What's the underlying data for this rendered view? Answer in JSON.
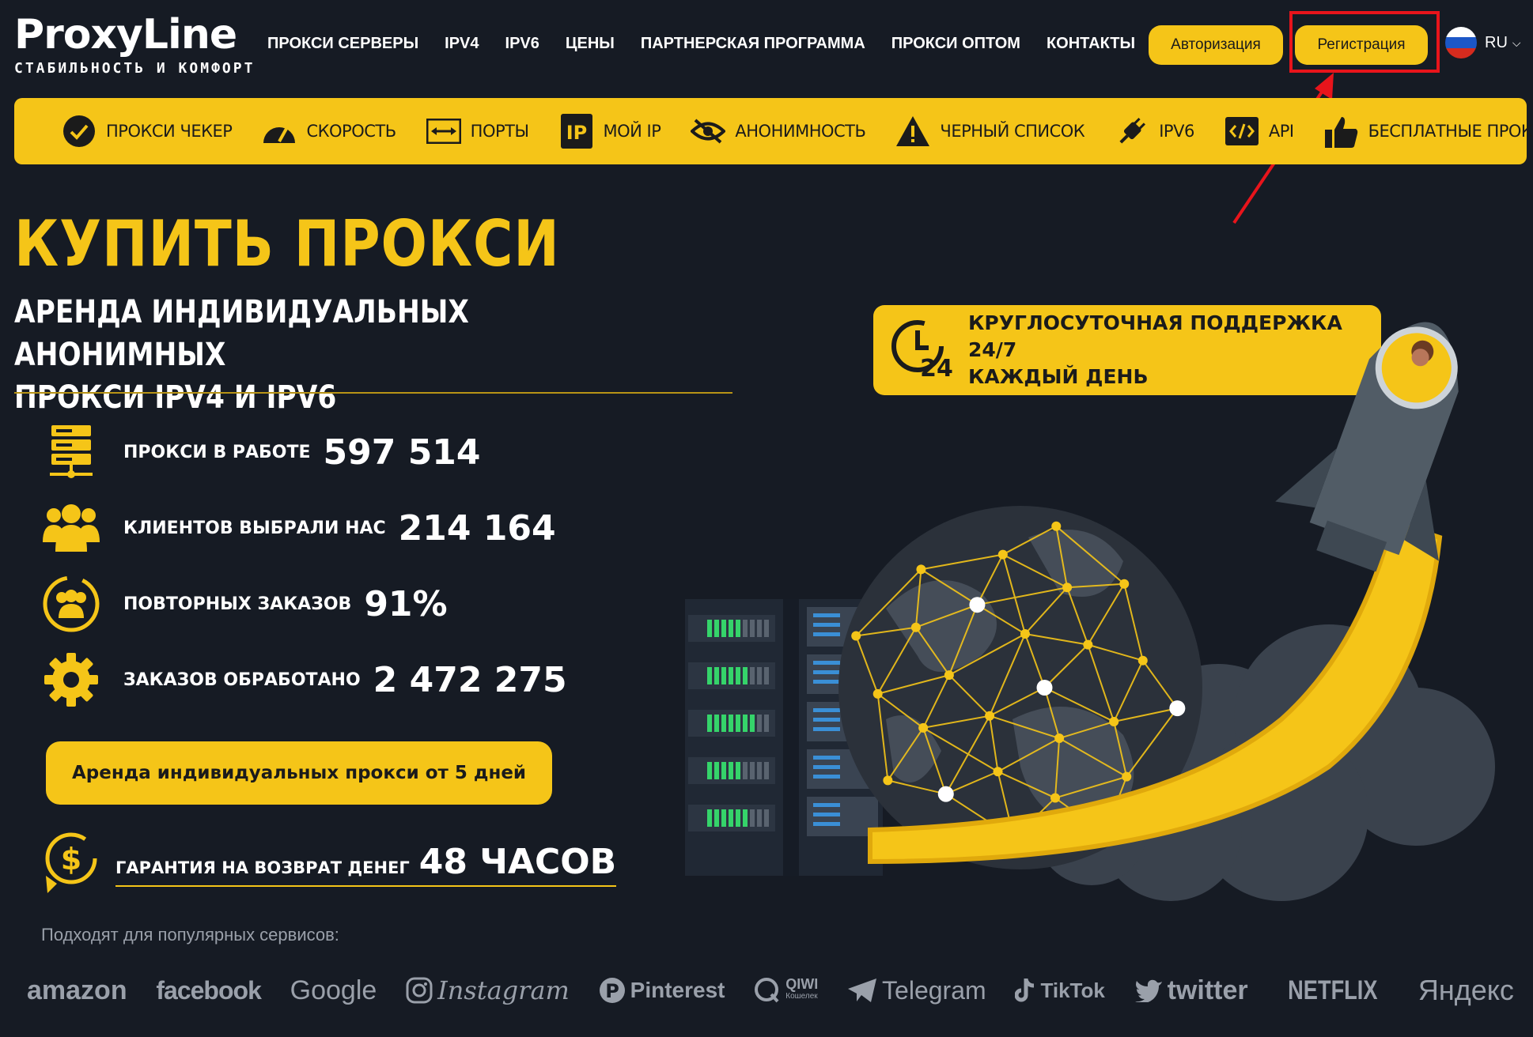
{
  "header": {
    "logo_main_a": "Proxy",
    "logo_main_b": "Line",
    "logo_sub": "СТАБИЛЬНОСТЬ И КОМФОРТ",
    "nav": [
      "ПРОКСИ СЕРВЕРЫ",
      "IPV4",
      "IPV6",
      "ЦЕНЫ",
      "ПАРТНЕРСКАЯ ПРОГРАММА",
      "ПРОКСИ ОПТОМ",
      "КОНТАКТЫ"
    ],
    "login_label": "Авторизация",
    "register_label": "Регистрация",
    "lang": "RU"
  },
  "toolbar": [
    {
      "label": "ПРОКСИ ЧЕКЕР",
      "icon": "check-circle-icon"
    },
    {
      "label": "СКОРОСТЬ",
      "icon": "speedometer-icon"
    },
    {
      "label": "ПОРТЫ",
      "icon": "arrows-horizontal-icon"
    },
    {
      "label": "МОЙ IP",
      "icon": "ip-icon"
    },
    {
      "label": "АНОНИМНОСТЬ",
      "icon": "eye-off-icon"
    },
    {
      "label": "ЧЕРНЫЙ СПИСОК",
      "icon": "warning-icon"
    },
    {
      "label": "IPV6",
      "icon": "plug-icon"
    },
    {
      "label": "API",
      "icon": "code-icon"
    },
    {
      "label": "БЕСПЛАТНЫЕ ПРОКСИ",
      "icon": "thumbs-up-icon"
    }
  ],
  "hero": {
    "title": "КУПИТЬ  ПРОКСИ",
    "subtitle_line1": "АРЕНДА ИНДИВИДУАЛЬНЫХ АНОНИМНЫХ",
    "subtitle_line2": "ПРОКСИ IPV4 И IPV6"
  },
  "stats": [
    {
      "label": "ПРОКСИ В РАБОТЕ",
      "value": "597 514",
      "icon": "server-icon"
    },
    {
      "label": "КЛИЕНТОВ ВЫБРАЛИ НАС",
      "value": "214 164",
      "icon": "users-icon"
    },
    {
      "label": "ПОВТОРНЫХ ЗАКАЗОВ",
      "value": "91%",
      "icon": "repeat-users-icon"
    },
    {
      "label": "ЗАКАЗОВ ОБРАБОТАНО",
      "value": "2 472 275",
      "icon": "gear-icon"
    }
  ],
  "rent_button": "Аренда индивидуальных прокси от 5 дней",
  "guarantee": {
    "label": "ГАРАНТИЯ НА ВОЗВРАТ ДЕНЕГ",
    "value": "48 ЧАСОВ"
  },
  "support": {
    "line1": "КРУГЛОСУТОЧНАЯ ПОДДЕРЖКА 24/7",
    "line2": "КАЖДЫЙ ДЕНЬ",
    "badge": "24"
  },
  "popular_label": "Подходят для популярных сервисов:",
  "brands": [
    "amazon",
    "facebook",
    "Google",
    "Instagram",
    "Pinterest",
    "QIWI",
    "Telegram",
    "TikTok",
    "twitter",
    "NETFLIX",
    "Яндекс"
  ],
  "brand_sub": {
    "qiwi": "Кошелек"
  },
  "colors": {
    "accent": "#f5c518",
    "background": "#161b24",
    "highlight": "#e8141b"
  }
}
